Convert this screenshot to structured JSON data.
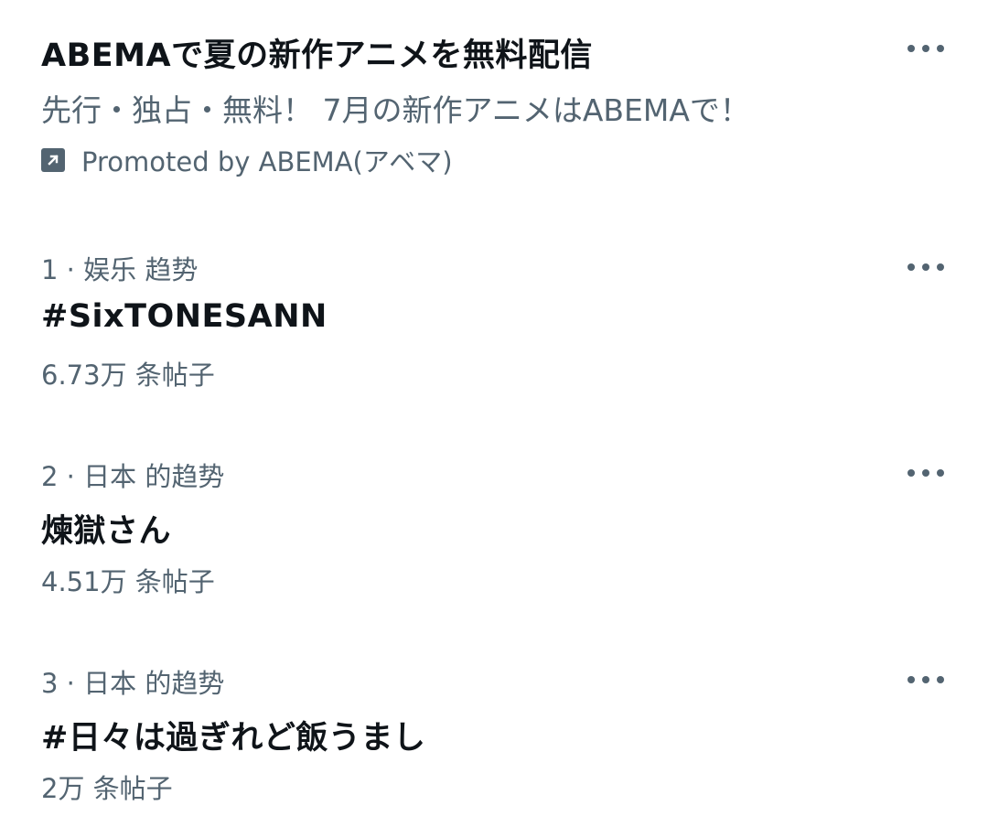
{
  "promoted": {
    "title": "ABEMAで夏の新作アニメを無料配信",
    "subtitle": "先行・独占・無料！ 7月の新作アニメはABEMAで！",
    "promoted_by": "Promoted by ABEMA(アベマ)",
    "icon": "promoted-arrow-icon"
  },
  "trends": [
    {
      "context": "1 · 娱乐 趋势",
      "name": "#SixTONESANN",
      "posts": "6.73万 条帖子"
    },
    {
      "context": "2 · 日本 的趋势",
      "name": "煉獄さん",
      "posts": "4.51万 条帖子"
    },
    {
      "context": "3 · 日本 的趋势",
      "name": "#日々は過ぎれど飯うまし",
      "posts": "2万 条帖子"
    }
  ],
  "colors": {
    "primary_text": "#0f1419",
    "secondary_text": "#536471",
    "background": "#ffffff"
  }
}
